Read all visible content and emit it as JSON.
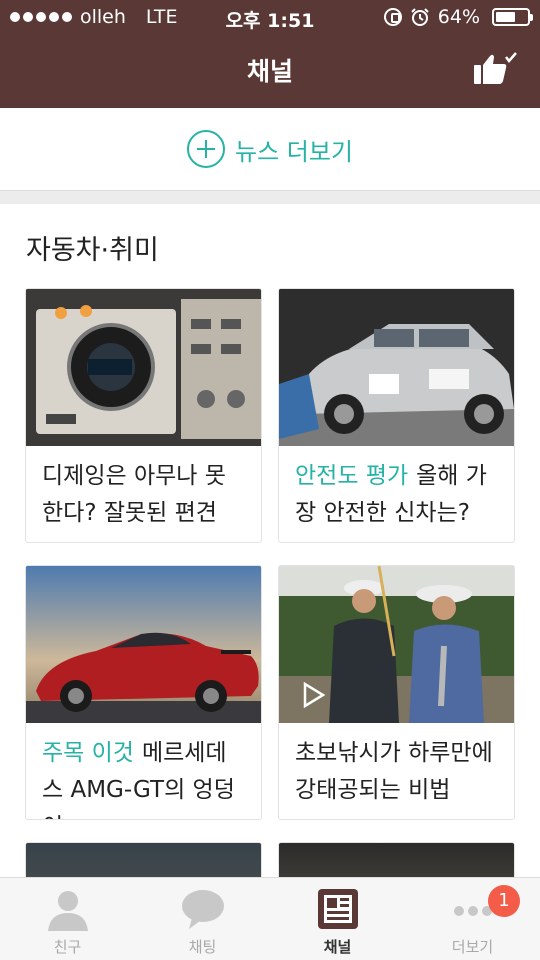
{
  "status": {
    "carrier": "olleh",
    "network": "LTE",
    "time": "오후 1:51",
    "battery": "64%",
    "battery_level": 0.64
  },
  "header": {
    "title": "채널",
    "like_icon": "thumbs-up-check-icon"
  },
  "news_more": {
    "label": "뉴스 더보기",
    "icon": "plus-circle-icon"
  },
  "section": {
    "title": "자동차·취미"
  },
  "cards": [
    {
      "tag": "",
      "text": "디제잉은 아무나 못한다? 잘못된 편견"
    },
    {
      "tag": "안전도 평가",
      "text": "올해 가장 안전한 신차는?"
    },
    {
      "tag": "주목 이것",
      "text": "메르세데스 AMG-GT의 엉덩이"
    },
    {
      "tag": "",
      "text": "초보낚시가 하루만에 강태공되는 비법"
    }
  ],
  "tabs": [
    {
      "label": "친구",
      "icon": "person-icon"
    },
    {
      "label": "채팅",
      "icon": "chat-bubble-icon"
    },
    {
      "label": "채널",
      "icon": "channel-news-icon"
    },
    {
      "label": "더보기",
      "icon": "more-dots-icon",
      "badge": "1"
    }
  ],
  "colors": {
    "header_bg": "#5a3835",
    "accent": "#26b3a6",
    "badge": "#f25c48"
  }
}
